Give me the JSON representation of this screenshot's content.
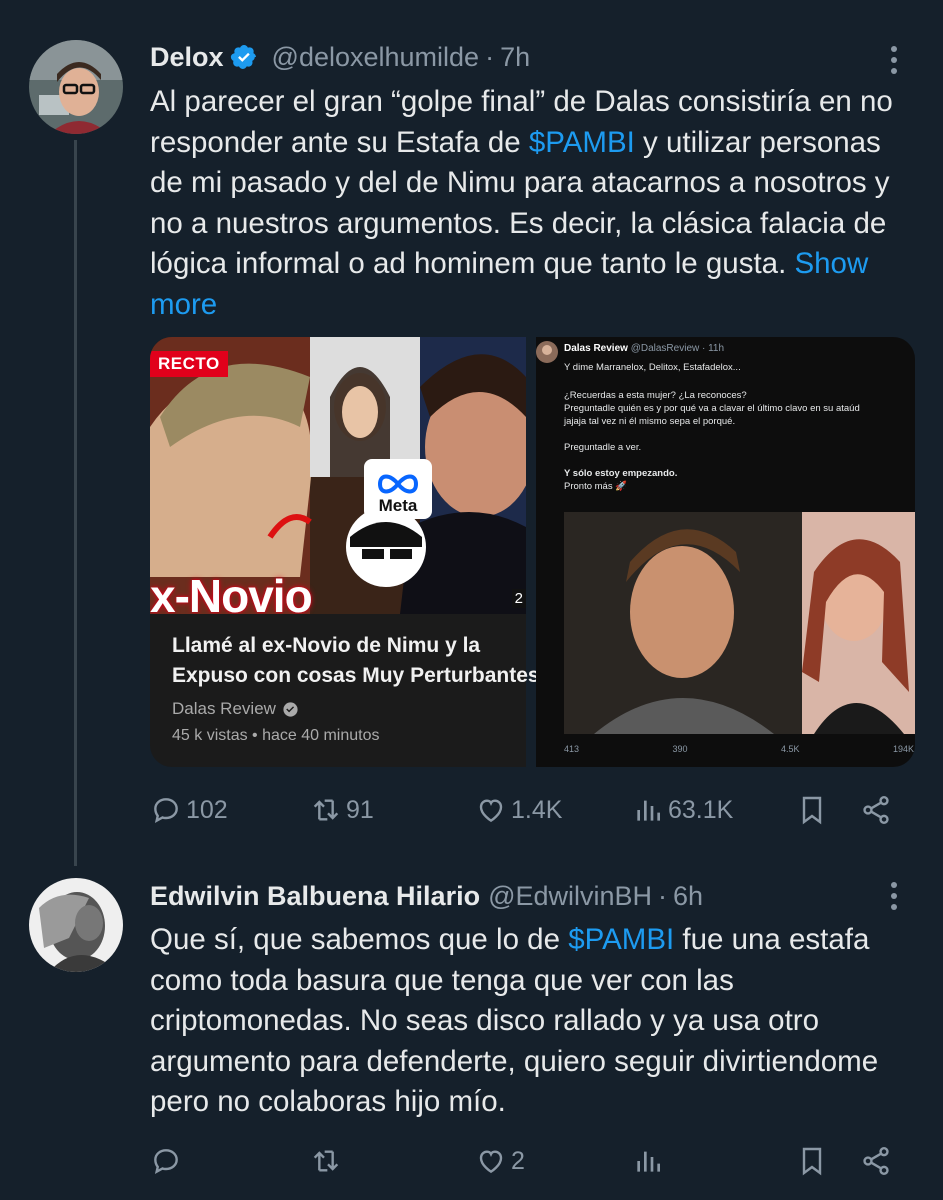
{
  "tweets": [
    {
      "name": "Delox",
      "handle": "@deloxelhumilde",
      "time": "7h",
      "text_parts": [
        "Al parecer el gran “golpe final” de Dalas consistiría en no responder ante su Estafa de ",
        "$PAMBI",
        " y utilizar personas de mi pasado y del de Nimu para atacarnos a nosotros y no a nuestros argumentos. Es decir, la clásica falacia de lógica informal o ad hominem que tanto le gusta. ",
        "Show more"
      ],
      "video_card": {
        "live_badge": "RECTO",
        "overlay_text": "x-Novio",
        "meta_label": "Meta",
        "duration": "2",
        "title_line1": "Llamé al ex-Novio de Nimu y la",
        "title_line2": "Expuso con cosas Muy Perturbantes",
        "channel": "Dalas Review",
        "stats": "45 k vistas • hace 40 minutos"
      },
      "embedded_tweet": {
        "name": "Dalas Review",
        "handle": "@DalasReview · 11h",
        "lines": [
          "Y dime Marranelox, Delitox, Estafadelox...",
          "",
          "¿Recuerdas a esta mujer? ¿La reconoces?",
          "Preguntadle quién es y por qué va a clavar el último clavo en su ataúd",
          "jajaja tal vez ni él mismo sepa el porqué.",
          "",
          "Preguntadle a ver.",
          "",
          "Y sólo estoy empezando.",
          "Pronto más 🚀"
        ],
        "replies": "413",
        "retweets": "390",
        "likes": "4.5K",
        "views": "194K"
      },
      "actions": {
        "replies": "102",
        "retweets": "91",
        "likes": "1.4K",
        "views": "63.1K"
      }
    },
    {
      "name": "Edwilvin Balbuena Hilario",
      "handle": "@EdwilvinBH",
      "time": "6h",
      "text_parts": [
        "Que sí, que sabemos que lo de ",
        "$PAMBI",
        " fue una estafa como toda basura que tenga que ver con las criptomonedas. No seas disco rallado y ya usa otro argumento para defenderte, quiero seguir divirtiendome pero no colaboras hijo mío."
      ],
      "actions": {
        "replies": "",
        "retweets": "",
        "likes": "2",
        "views": ""
      }
    }
  ],
  "colors": {
    "background": "#15202b",
    "text": "#e7e9ea",
    "muted": "#8b98a5",
    "link": "#1d9bf0",
    "thread_line": "#38444d"
  },
  "icons": [
    "verified-badge-icon",
    "more-options-icon",
    "reply-icon",
    "retweet-icon",
    "like-icon",
    "views-icon",
    "bookmark-icon",
    "share-icon"
  ]
}
